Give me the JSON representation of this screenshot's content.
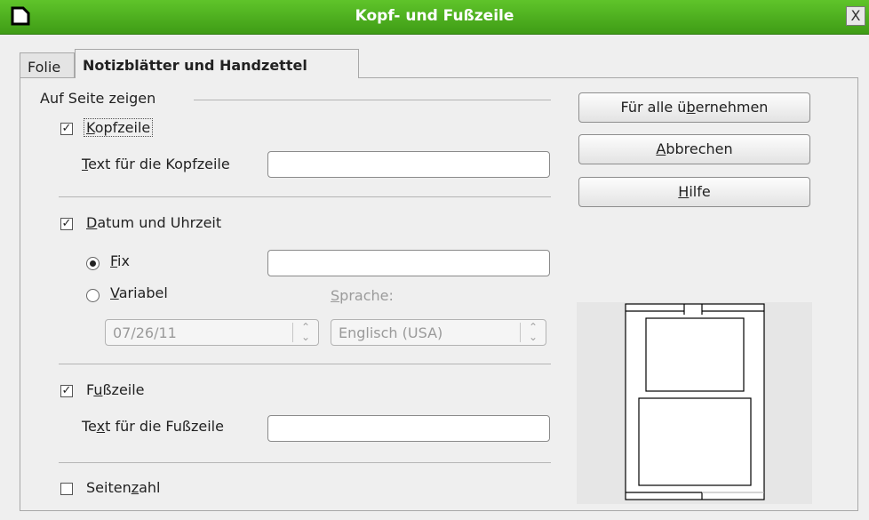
{
  "window": {
    "title": "Kopf- und Fußzeile",
    "close_label": "X"
  },
  "tabs": [
    {
      "label": "Folie",
      "active": false
    },
    {
      "label": "Notizblätter und Handzettel",
      "active": true
    }
  ],
  "group": {
    "label": "Auf Seite zeigen"
  },
  "header": {
    "checkbox": {
      "pre": "",
      "u": "K",
      "post": "opfzeile",
      "checked": true
    },
    "text_label": {
      "pre": "",
      "u": "T",
      "post": "ext für die Kopfzeile"
    },
    "text_value": ""
  },
  "datetime": {
    "checkbox": {
      "pre": "",
      "u": "D",
      "post": "atum und Uhrzeit",
      "checked": true
    },
    "fix": {
      "pre": "",
      "u": "F",
      "post": "ix",
      "selected": true
    },
    "fix_value": "",
    "variable": {
      "pre": "",
      "u": "V",
      "post": "ariabel",
      "selected": false
    },
    "language_label": {
      "pre": "",
      "u": "S",
      "post": "prache:"
    },
    "date_format_value": "07/26/11",
    "language_value": "Englisch (USA)"
  },
  "footer": {
    "checkbox": {
      "pre": "F",
      "u": "u",
      "post": "ßzeile",
      "checked": true
    },
    "text_label": {
      "pre": "Te",
      "u": "x",
      "post": "t für die Fußzeile"
    },
    "text_value": ""
  },
  "page_number": {
    "checkbox": {
      "pre": "Seiten",
      "u": "z",
      "post": "ahl",
      "checked": false
    }
  },
  "buttons": {
    "apply_all": {
      "pre": "Für alle ü",
      "u": "b",
      "post": "ernehmen"
    },
    "cancel": {
      "pre": "",
      "u": "A",
      "post": "bbrechen"
    },
    "help": {
      "pre": "",
      "u": "H",
      "post": "ilfe"
    }
  },
  "icons": {
    "checkmark": "✓",
    "spin": "spin-arrows-icon"
  }
}
